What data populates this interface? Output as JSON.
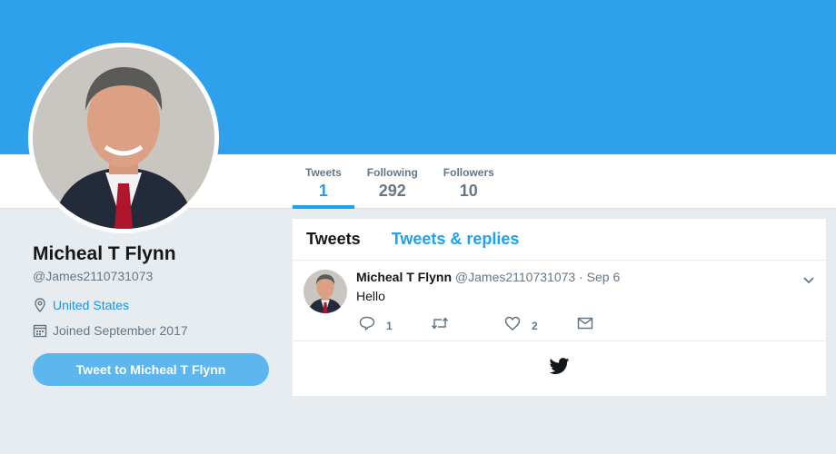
{
  "profile": {
    "name": "Micheal T Flynn",
    "handle": "@James2110731073",
    "location": "United States",
    "joined": "Joined September 2017",
    "tweet_to_label": "Tweet to Micheal T Flynn"
  },
  "stats": [
    {
      "label": "Tweets",
      "value": "1"
    },
    {
      "label": "Following",
      "value": "292"
    },
    {
      "label": "Followers",
      "value": "10"
    }
  ],
  "timeline": {
    "tabs": [
      "Tweets",
      "Tweets & replies"
    ],
    "tweet": {
      "name": "Micheal T Flynn",
      "handle": "@James2110731073",
      "separator": "·",
      "date": "Sep 6",
      "text": "Hello",
      "reply_count": "1",
      "retweet_count": "",
      "like_count": "2"
    }
  },
  "colors": {
    "banner": "#2fa0ec",
    "accent": "#1da1f2",
    "button": "#5eb6ee",
    "background": "#e6ecf0"
  },
  "icons": [
    "location-pin-icon",
    "calendar-icon",
    "reply-icon",
    "retweet-icon",
    "heart-icon",
    "envelope-icon",
    "chevron-down-icon",
    "twitter-bird-icon"
  ]
}
